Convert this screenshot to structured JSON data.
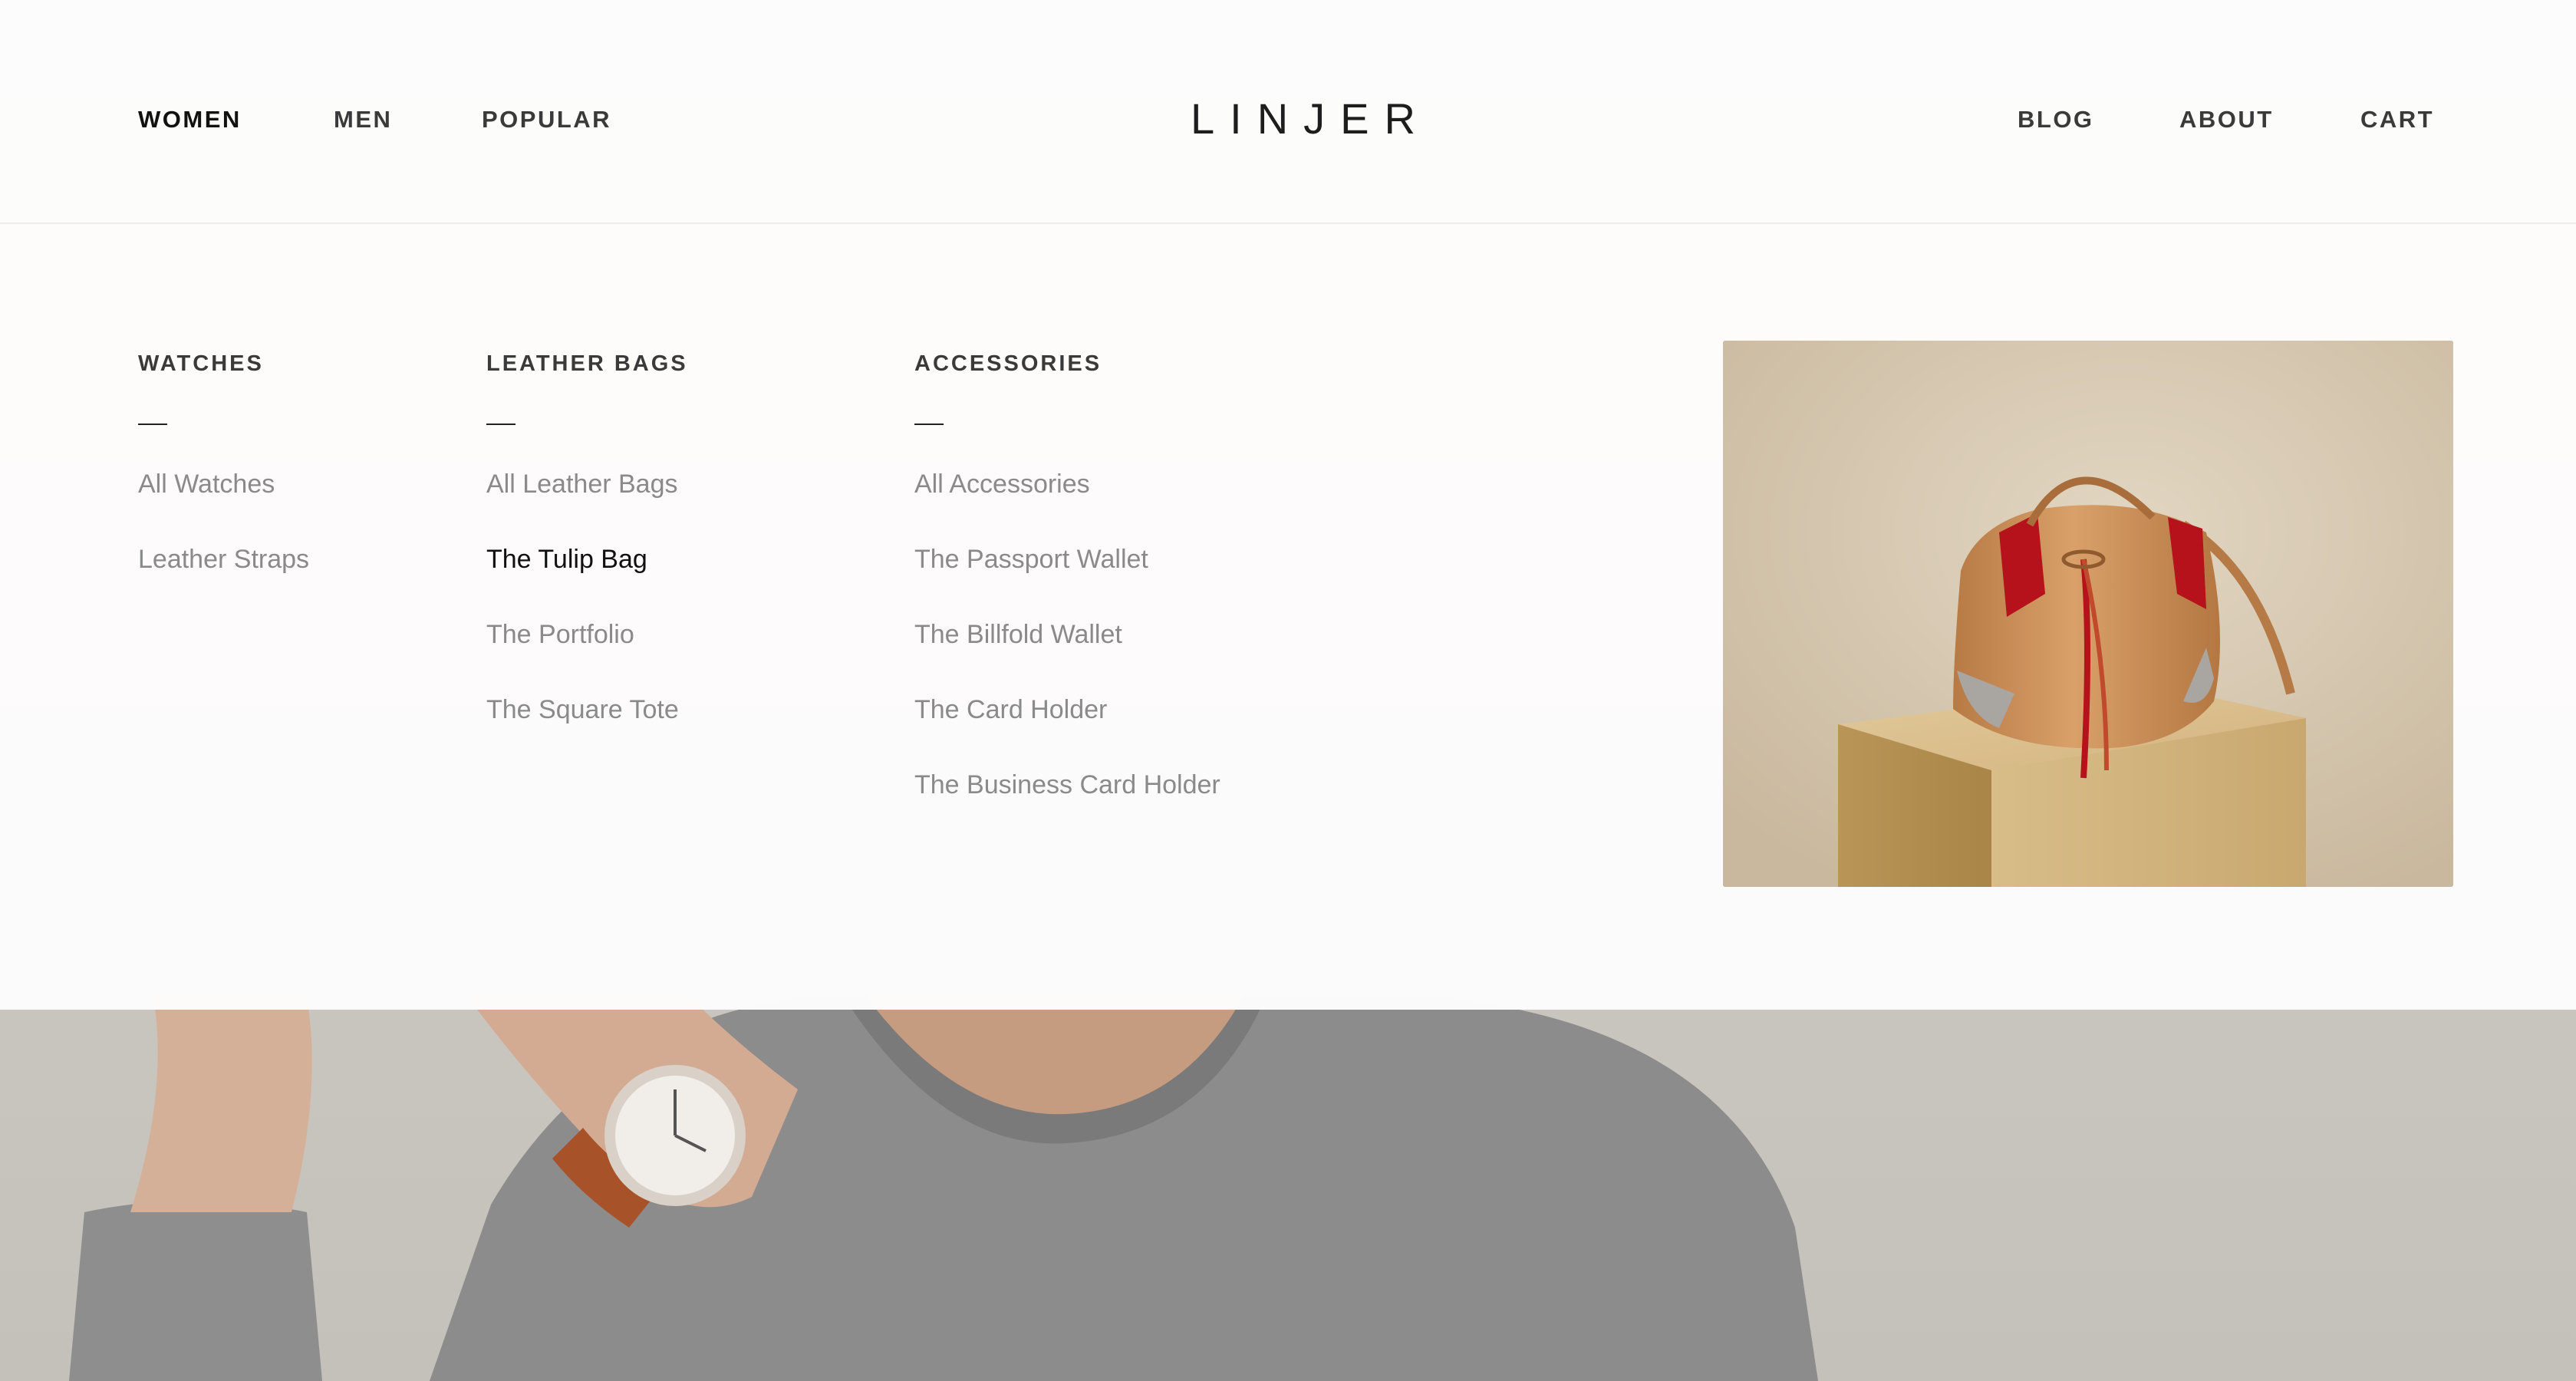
{
  "header": {
    "brand": "LINJER",
    "left_nav": [
      {
        "label": "WOMEN",
        "active": true
      },
      {
        "label": "MEN",
        "active": false
      },
      {
        "label": "POPULAR",
        "active": false
      }
    ],
    "right_nav": [
      {
        "label": "BLOG"
      },
      {
        "label": "ABOUT"
      },
      {
        "label": "CART"
      }
    ]
  },
  "mega_menu": {
    "columns": [
      {
        "heading": "WATCHES",
        "items": [
          "All Watches",
          "Leather Straps"
        ]
      },
      {
        "heading": "LEATHER BAGS",
        "items": [
          "All Leather Bags",
          "The Tulip Bag",
          "The Portfolio",
          "The Square Tote"
        ],
        "current_item": "The Tulip Bag"
      },
      {
        "heading": "ACCESSORIES",
        "items": [
          "All Accessories",
          "The Passport Wallet",
          "The Billfold Wallet",
          "The Card Holder",
          "The Business Card Holder"
        ]
      }
    ],
    "feature_image": "tan leather bucket bag on wooden pedestal"
  },
  "colors": {
    "nav_text": "#3a3a3a",
    "menu_item": "#8a8a8a",
    "menu_item_current": "#111111",
    "bag_tan": "#c8935f",
    "bag_red": "#b5121b"
  }
}
